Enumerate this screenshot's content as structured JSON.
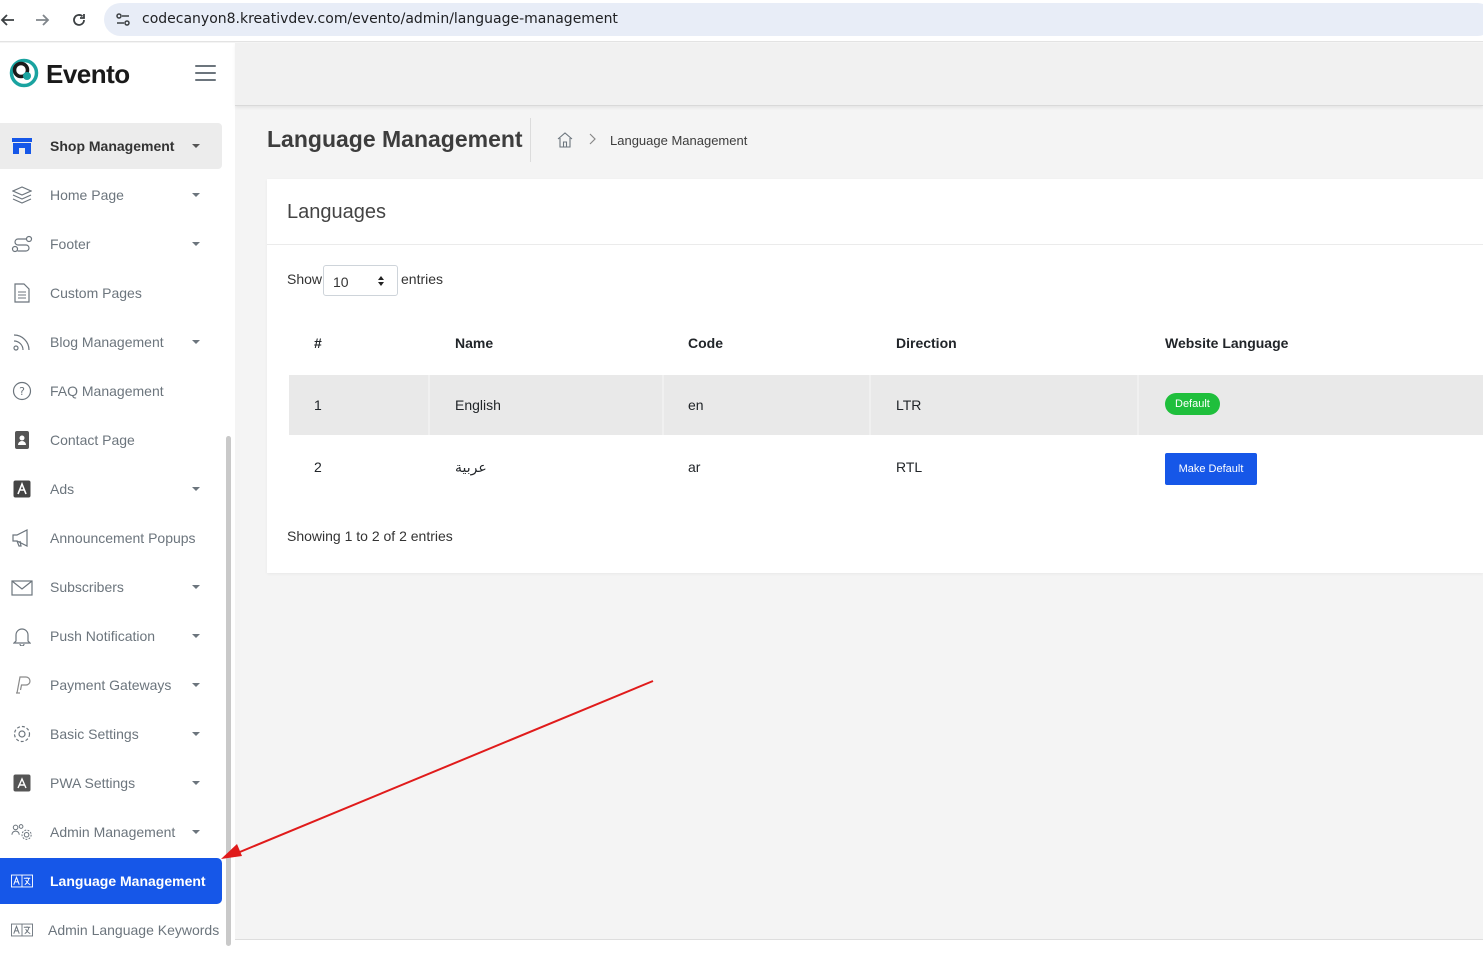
{
  "browser": {
    "url": "codecanyon8.kreativdev.com/evento/admin/language-management",
    "icons": [
      "back-arrow-icon",
      "forward-arrow-icon",
      "reload-icon",
      "site-settings-icon"
    ]
  },
  "brand": {
    "name": "Evento",
    "accent": "#1657e8",
    "logo_color": "#1aa3a0"
  },
  "sidebar": {
    "items": [
      {
        "label": "Shop Management",
        "icon": "store-icon",
        "has_caret": true
      },
      {
        "label": "Home Page",
        "icon": "layers-icon",
        "has_caret": true
      },
      {
        "label": "Footer",
        "icon": "route-icon",
        "has_caret": true
      },
      {
        "label": "Custom Pages",
        "icon": "document-icon",
        "has_caret": false
      },
      {
        "label": "Blog Management",
        "icon": "feed-icon",
        "has_caret": true
      },
      {
        "label": "FAQ Management",
        "icon": "question-icon",
        "has_caret": false
      },
      {
        "label": "Contact Page",
        "icon": "contact-book-icon",
        "has_caret": false
      },
      {
        "label": "Ads",
        "icon": "ads-icon",
        "has_caret": true
      },
      {
        "label": "Announcement Popups",
        "icon": "megaphone-icon",
        "has_caret": false
      },
      {
        "label": "Subscribers",
        "icon": "envelope-icon",
        "has_caret": true
      },
      {
        "label": "Push Notification",
        "icon": "bell-icon",
        "has_caret": true
      },
      {
        "label": "Payment Gateways",
        "icon": "paypal-icon",
        "has_caret": true
      },
      {
        "label": "Basic Settings",
        "icon": "gear-icon",
        "has_caret": true
      },
      {
        "label": "PWA Settings",
        "icon": "app-store-icon",
        "has_caret": true
      },
      {
        "label": "Admin Management",
        "icon": "users-gear-icon",
        "has_caret": true
      },
      {
        "label": "Language Management",
        "icon": "translate-icon",
        "has_caret": false
      },
      {
        "label": "Admin Language Keywords",
        "icon": "translate-icon",
        "has_caret": false
      }
    ]
  },
  "page": {
    "title": "Language Management",
    "breadcrumb": "Language Management"
  },
  "card": {
    "title": "Languages",
    "show_label": "Show",
    "page_size": "10",
    "entries_label": "entries",
    "columns": [
      "#",
      "Name",
      "Code",
      "Direction",
      "Website Language"
    ],
    "rows": [
      {
        "num": "1",
        "name": "English",
        "code": "en",
        "direction": "LTR",
        "action": "Default"
      },
      {
        "num": "2",
        "name": "عربية",
        "code": "ar",
        "direction": "RTL",
        "action": "Make Default"
      }
    ],
    "summary": "Showing 1 to 2 of 2 entries"
  },
  "colors": {
    "default_badge": "#1fbf3c",
    "make_default_button": "#1657e8",
    "annotation_arrow": "#e01b1b"
  }
}
